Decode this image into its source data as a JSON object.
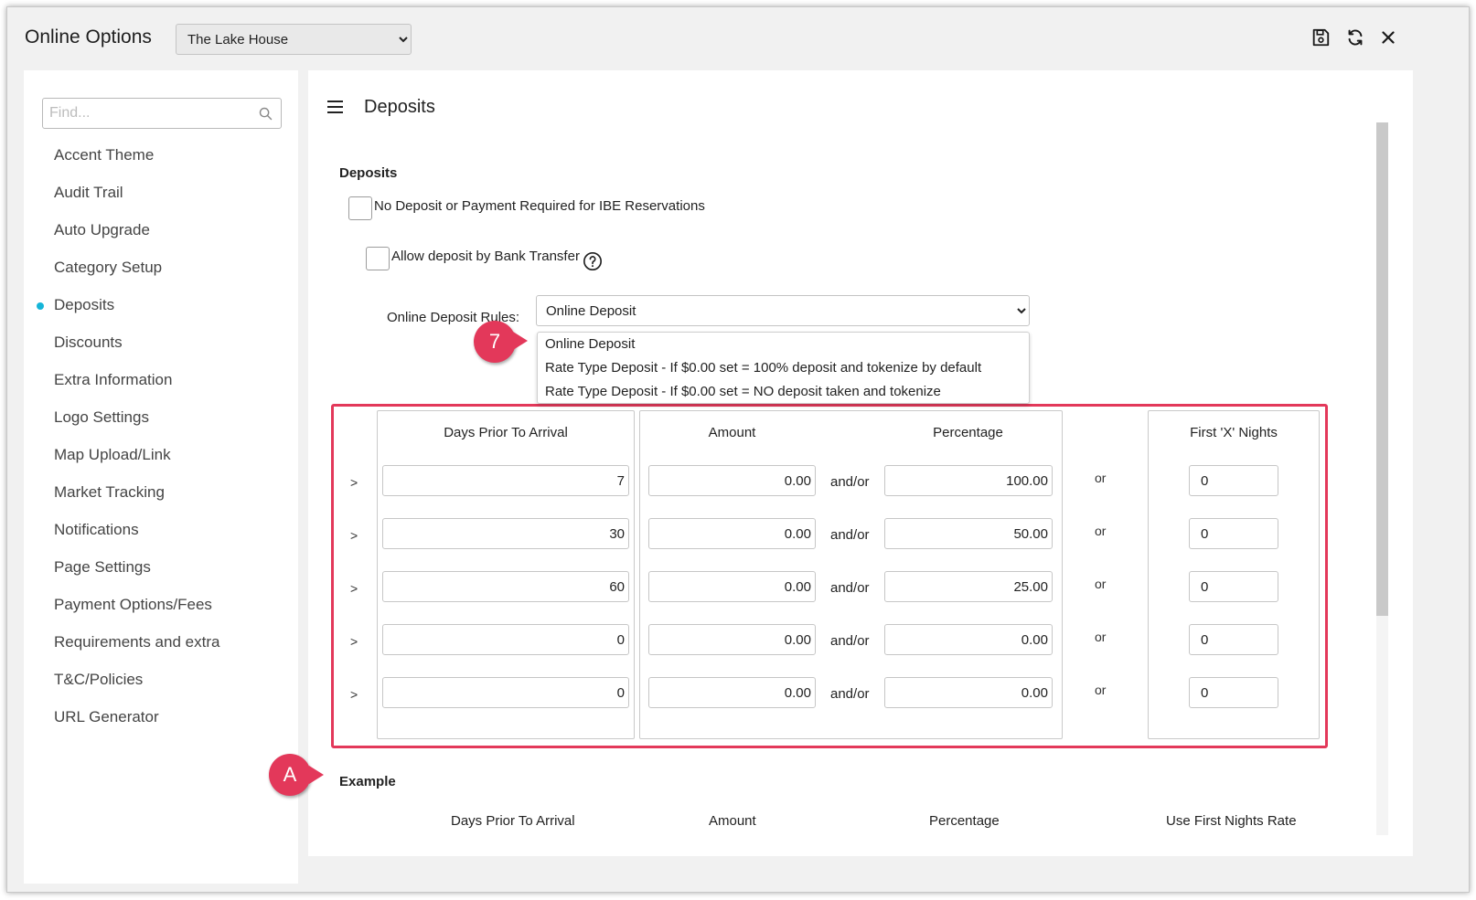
{
  "window": {
    "title": "Online Options"
  },
  "property_select": {
    "value": "The Lake House"
  },
  "toolbar": {
    "save_icon": "save-icon",
    "refresh_icon": "refresh-icon",
    "close_icon": "close-icon"
  },
  "sidebar": {
    "search_placeholder": "Find...",
    "items": [
      {
        "label": "Accent Theme"
      },
      {
        "label": "Audit Trail"
      },
      {
        "label": "Auto Upgrade"
      },
      {
        "label": "Category Setup"
      },
      {
        "label": "Deposits",
        "active": true
      },
      {
        "label": "Discounts"
      },
      {
        "label": "Extra Information"
      },
      {
        "label": "Logo Settings"
      },
      {
        "label": "Map Upload/Link"
      },
      {
        "label": "Market Tracking"
      },
      {
        "label": "Notifications"
      },
      {
        "label": "Page Settings"
      },
      {
        "label": "Payment Options/Fees"
      },
      {
        "label": "Requirements and extra"
      },
      {
        "label": "T&C/Policies"
      },
      {
        "label": "URL Generator"
      }
    ],
    "active_color": "#15b5d8"
  },
  "main": {
    "title": "Deposits",
    "section_label": "Deposits",
    "no_deposit_label": "No Deposit or Payment Required for IBE Reservations",
    "bank_transfer_label": "Allow deposit by Bank Transfer",
    "rules_label": "Online Deposit Rules:",
    "rules_value": "Online Deposit",
    "rules_options": [
      "Online Deposit",
      "Rate Type Deposit - If $0.00 set = 100% deposit and tokenize by default",
      "Rate Type Deposit - If $0.00 set = NO deposit taken and tokenize"
    ],
    "table": {
      "headers": {
        "days": "Days Prior To Arrival",
        "amount": "Amount",
        "percentage": "Percentage",
        "nights": "First 'X' Nights"
      },
      "gt_symbol": ">",
      "andor": "and/or",
      "or": "or",
      "rows": [
        {
          "days": "7",
          "amount": "0.00",
          "percentage": "100.00",
          "nights": "0"
        },
        {
          "days": "30",
          "amount": "0.00",
          "percentage": "50.00",
          "nights": "0"
        },
        {
          "days": "60",
          "amount": "0.00",
          "percentage": "25.00",
          "nights": "0"
        },
        {
          "days": "0",
          "amount": "0.00",
          "percentage": "0.00",
          "nights": "0"
        },
        {
          "days": "0",
          "amount": "0.00",
          "percentage": "0.00",
          "nights": "0"
        }
      ]
    },
    "example": {
      "title": "Example",
      "headers": {
        "days": "Days Prior To Arrival",
        "amount": "Amount",
        "percentage": "Percentage",
        "first_nights": "Use First Nights Rate"
      }
    }
  },
  "callouts": {
    "seven": "7",
    "a": "A"
  },
  "colors": {
    "callout": "#e3385a",
    "highlight": "#e3385a"
  }
}
